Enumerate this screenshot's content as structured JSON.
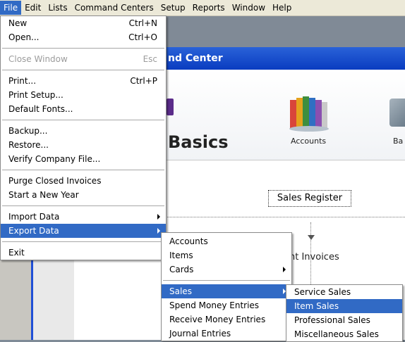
{
  "menubar": [
    "File",
    "Edit",
    "Lists",
    "Command Centers",
    "Setup",
    "Reports",
    "Window",
    "Help"
  ],
  "window": {
    "title_fragment": "nd Center",
    "banner_text": "Basics",
    "accounts_label": "Accounts",
    "ba_label": "Ba",
    "sales_register": "Sales Register",
    "nt_invoices": "nt Invoices"
  },
  "file_menu": {
    "new": {
      "label": "New",
      "shortcut": "Ctrl+N"
    },
    "open": {
      "label": "Open...",
      "shortcut": "Ctrl+O"
    },
    "close": {
      "label": "Close Window",
      "shortcut": "Esc"
    },
    "print": {
      "label": "Print...",
      "shortcut": "Ctrl+P"
    },
    "print_setup": {
      "label": "Print Setup..."
    },
    "default_fonts": {
      "label": "Default Fonts..."
    },
    "backup": {
      "label": "Backup..."
    },
    "restore": {
      "label": "Restore..."
    },
    "verify": {
      "label": "Verify Company File..."
    },
    "purge": {
      "label": "Purge Closed Invoices"
    },
    "new_year": {
      "label": "Start a New Year"
    },
    "import": {
      "label": "Import Data"
    },
    "export": {
      "label": "Export Data"
    },
    "exit": {
      "label": "Exit"
    }
  },
  "export_menu": {
    "accounts": "Accounts",
    "items": "Items",
    "cards": "Cards",
    "sales": "Sales",
    "spend": "Spend Money Entries",
    "receive": "Receive Money Entries",
    "journal": "Journal Entries"
  },
  "sales_menu": {
    "service": "Service Sales",
    "item": "Item Sales",
    "professional": "Professional Sales",
    "misc": "Miscellaneous Sales"
  },
  "colors": {
    "highlight": "#316ac5",
    "titlebar": "#0a3cc0"
  }
}
